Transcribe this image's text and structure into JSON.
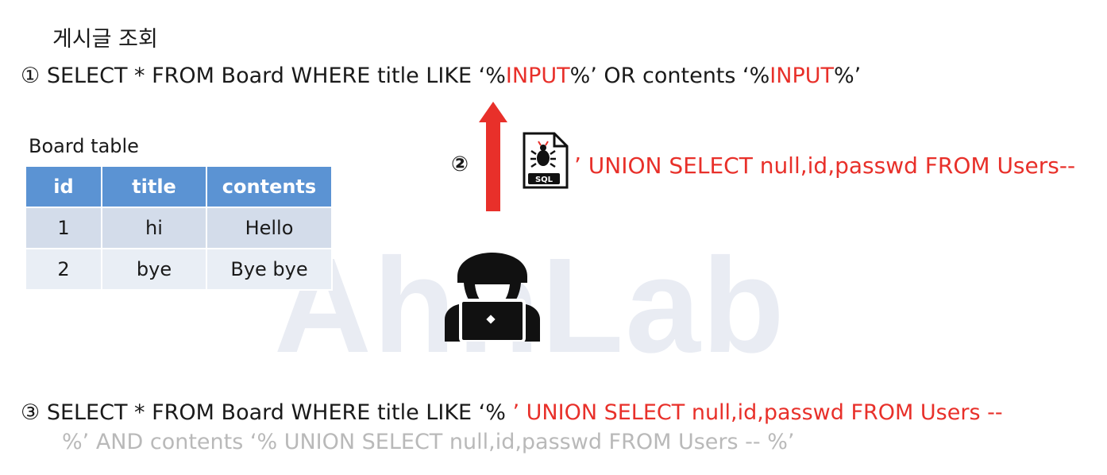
{
  "watermark": "AhnLab",
  "title": "게시글 조회",
  "step1": {
    "marker": "①",
    "prefix": "SELECT * FROM Board WHERE title LIKE ‘%",
    "input1": "INPUT",
    "middle": "%’ OR contents ‘%",
    "input2": "INPUT",
    "suffix": "%’"
  },
  "board": {
    "label": "Board table",
    "headers": [
      "id",
      "title",
      "contents"
    ],
    "rows": [
      [
        "1",
        "hi",
        "Hello"
      ],
      [
        "2",
        "bye",
        "Bye bye"
      ]
    ]
  },
  "step2": {
    "marker": "②",
    "file_tag": "SQL",
    "file_icon": "sql-bug-file-icon",
    "payload": "’ UNION SELECT null,id,passwd FROM Users--"
  },
  "attacker_icon": "hacker-at-laptop-icon",
  "colors": {
    "accent_red": "#e8302a",
    "table_header": "#5b93d3",
    "row_dark": "#d3dcea",
    "row_light": "#e9eef5",
    "faded_text": "#b9b9b9"
  },
  "step3": {
    "marker": "③",
    "prefix": "SELECT * FROM Board WHERE title LIKE ‘% ",
    "injected": "’ UNION SELECT null,id,passwd FROM Users --",
    "commented": "%’ AND contents ‘% UNION SELECT null,id,passwd FROM Users -- %’"
  }
}
